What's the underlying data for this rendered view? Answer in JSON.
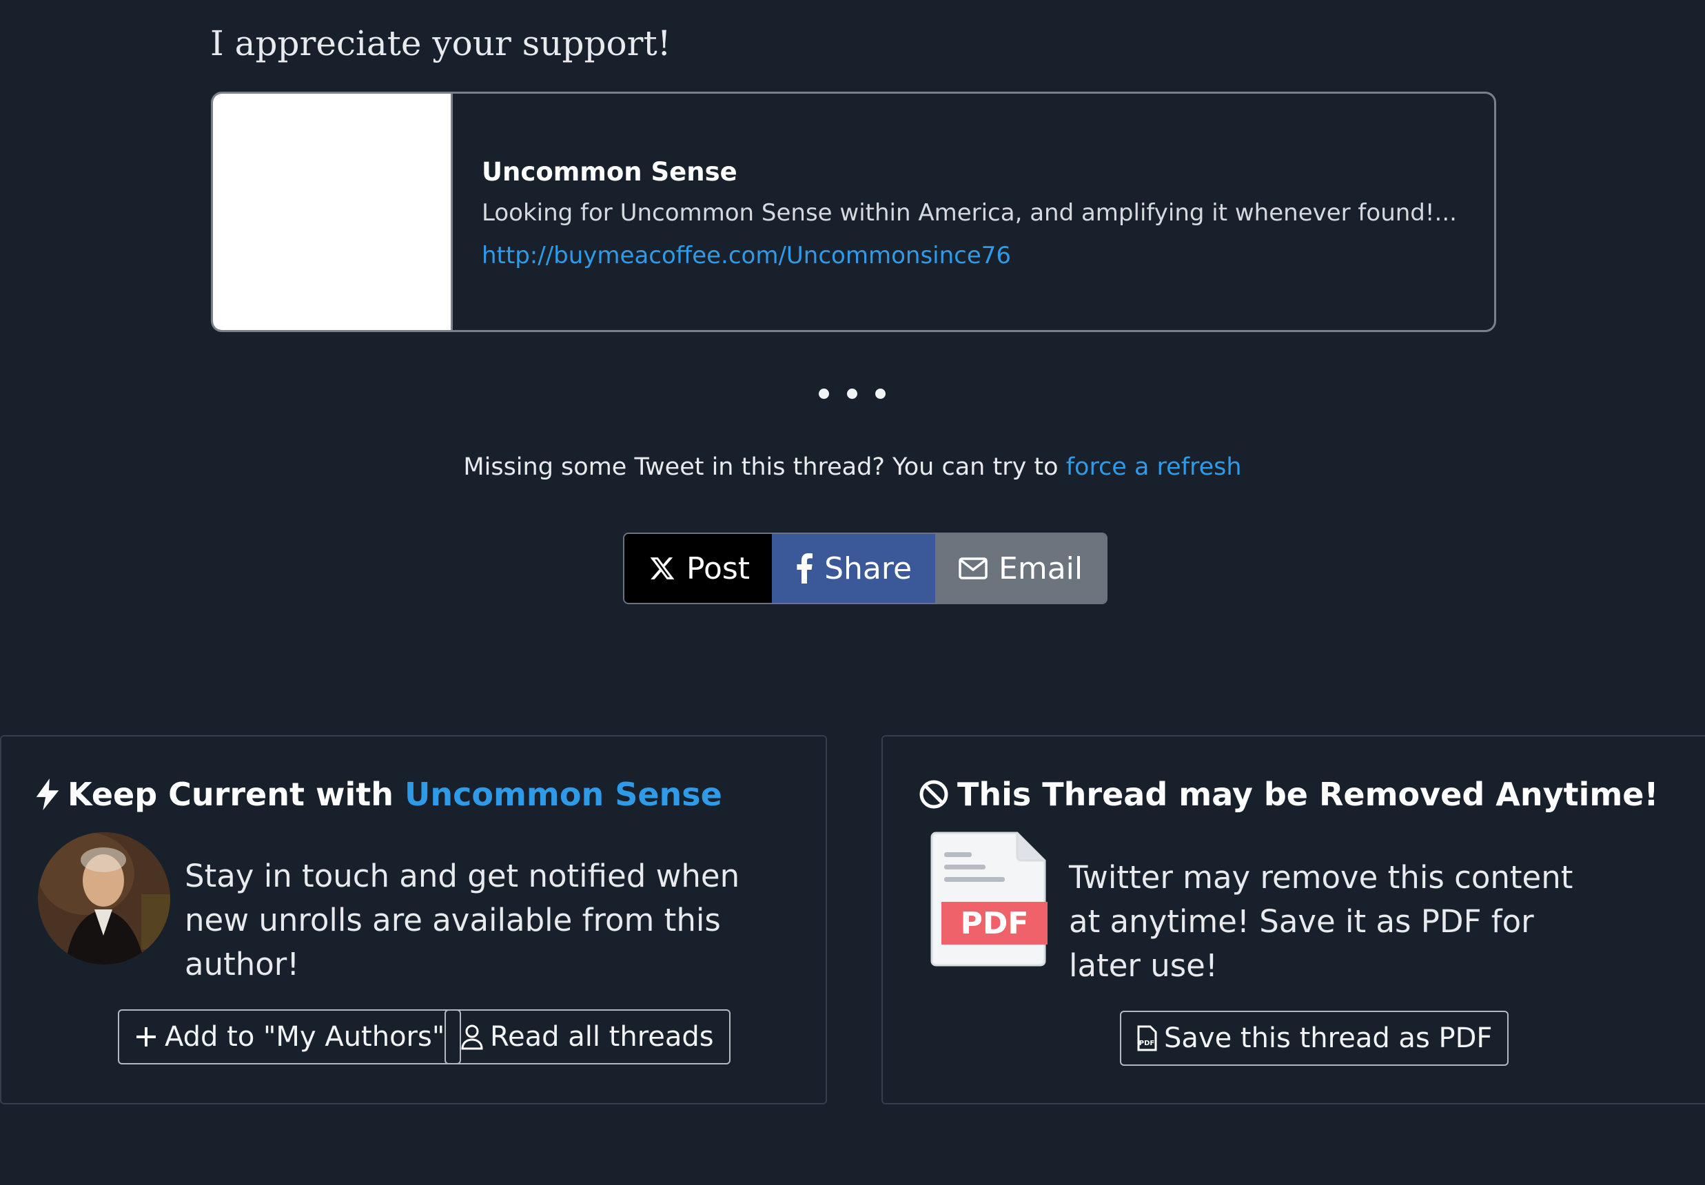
{
  "support": {
    "title": "I appreciate your support!"
  },
  "preview": {
    "name": "Uncommon Sense",
    "description": "Looking for Uncommon Sense within America, and amplifying it whenever found!...",
    "url": "http://buymeacoffee.com/Uncommonsince76"
  },
  "notice": {
    "text": "Missing some Tweet in this thread? You can try to ",
    "link": "force a refresh"
  },
  "share": {
    "post_label": "Post",
    "share_label": "Share",
    "email_label": "Email",
    "colors": {
      "post": "#000000",
      "share": "#3b5998",
      "email": "#6c757d"
    }
  },
  "keep_current": {
    "title_prefix": "Keep Current with ",
    "author": "Uncommon Sense",
    "text": "Stay in touch and get notified when new unrolls are available from this author!",
    "add_label": "Add to \"My Authors\"",
    "read_label": "Read all threads",
    "icons": [
      "lightning-icon",
      "plus-icon",
      "person-icon"
    ]
  },
  "removal": {
    "title": "This Thread may be Removed Anytime!",
    "text": "Twitter may remove this content at anytime! Save it as PDF for later use!",
    "pdf_badge": "PDF",
    "save_label": "Save this thread as PDF",
    "icons": [
      "ban-icon",
      "pdf-file-icon",
      "pdf-small-icon"
    ]
  },
  "colors": {
    "background": "#18202b",
    "accent": "#2f9be8"
  }
}
